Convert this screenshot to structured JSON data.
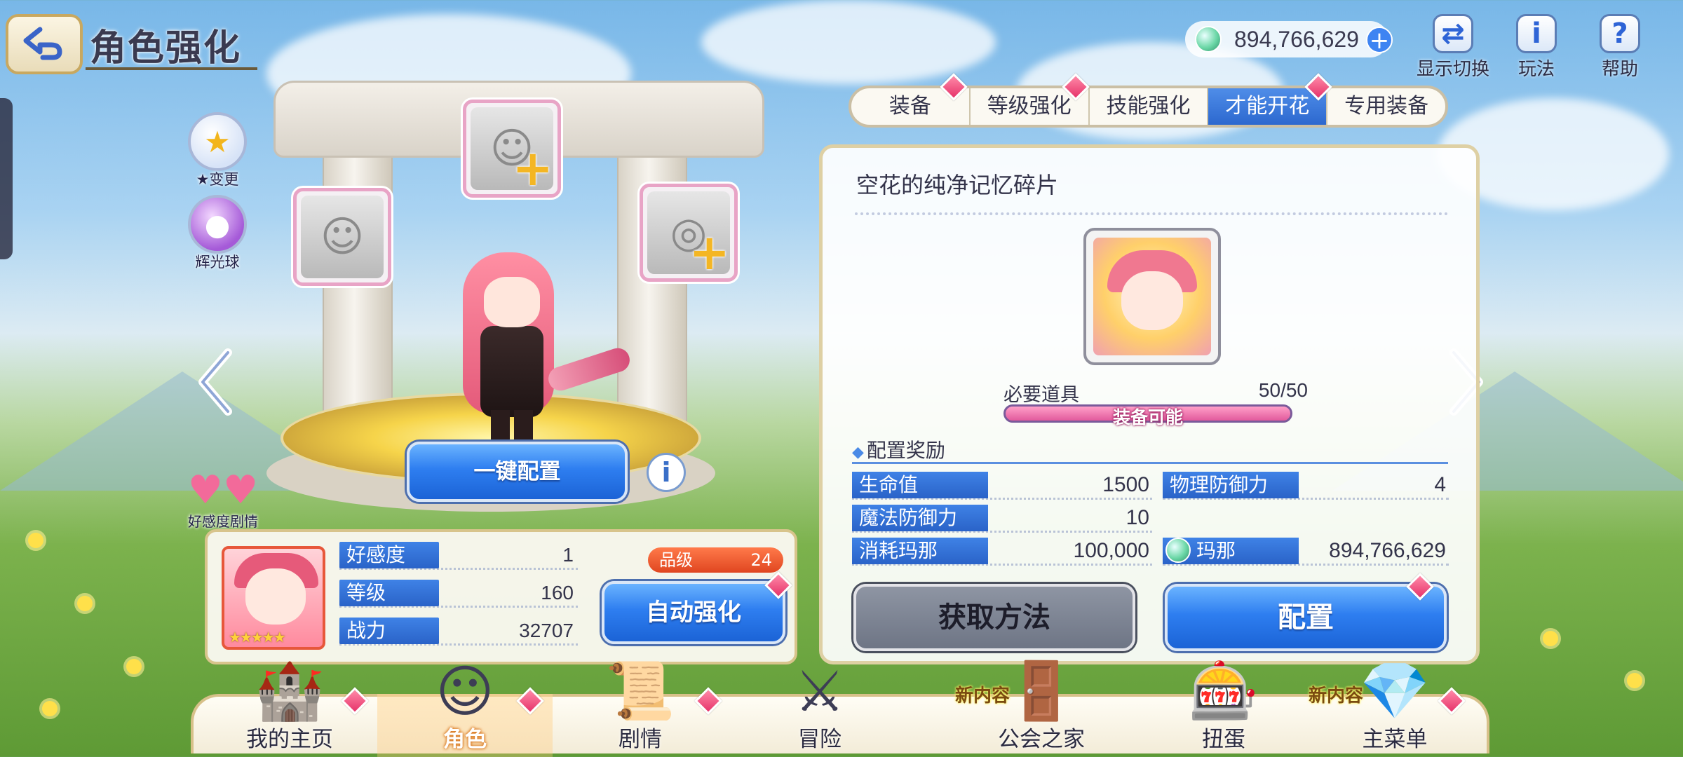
{
  "header": {
    "title": "角色强化",
    "currency_value": "894,766,629",
    "top_buttons": [
      {
        "label": "显示切换",
        "icon": "character-switch-icon"
      },
      {
        "label": "玩法",
        "icon": "info-icon"
      },
      {
        "label": "帮助",
        "icon": "help-icon"
      }
    ]
  },
  "side_buttons": {
    "star_change": "★变更",
    "glow_orb": "辉光球",
    "affection_story": "好感度剧情"
  },
  "left": {
    "one_click_label": "一键配置",
    "stats": [
      {
        "label": "好感度",
        "value": "1"
      },
      {
        "label": "等级",
        "value": "160"
      },
      {
        "label": "战力",
        "value": "32707"
      }
    ],
    "rank_label": "品级",
    "rank_value": "24",
    "auto_enhance_label": "自动强化",
    "stars": "★★★★★"
  },
  "tabs": [
    {
      "label": "装备",
      "active": false
    },
    {
      "label": "等级强化",
      "active": false
    },
    {
      "label": "技能强化",
      "active": false
    },
    {
      "label": "才能开花",
      "active": true
    },
    {
      "label": "专用装备",
      "active": false
    }
  ],
  "item_panel": {
    "item_name": "空花的纯净记忆碎片",
    "required_label": "必要道具",
    "required_value": "50/50",
    "bar_text": "装备可能",
    "bar_progress": 1.0,
    "reward_header": "配置奖励",
    "rewards": [
      {
        "label": "生命值",
        "value": "1500"
      },
      {
        "label": "物理防御力",
        "value": "4"
      },
      {
        "label": "魔法防御力",
        "value": "10"
      }
    ],
    "cost_label": "消耗玛那",
    "cost_value": "100,000",
    "mana_label": "玛那",
    "mana_value": "894,766,629",
    "obtain_label": "获取方法",
    "equip_label": "配置"
  },
  "bottom_nav": [
    {
      "label": "我的主页",
      "badge": "",
      "active": false
    },
    {
      "label": "角色",
      "badge": "",
      "active": true
    },
    {
      "label": "剧情",
      "badge": "",
      "active": false
    },
    {
      "label": "冒险",
      "badge": "",
      "active": false
    },
    {
      "label": "公会之家",
      "badge": "新内容",
      "active": false
    },
    {
      "label": "扭蛋",
      "badge": "",
      "active": false
    },
    {
      "label": "主菜单",
      "badge": "新内容",
      "active": false
    }
  ],
  "colors": {
    "accent_blue": "#2e7ef0",
    "rank_orange": "#e04620",
    "badge_pink": "#e6336a",
    "panel_border": "#d8c48c"
  }
}
